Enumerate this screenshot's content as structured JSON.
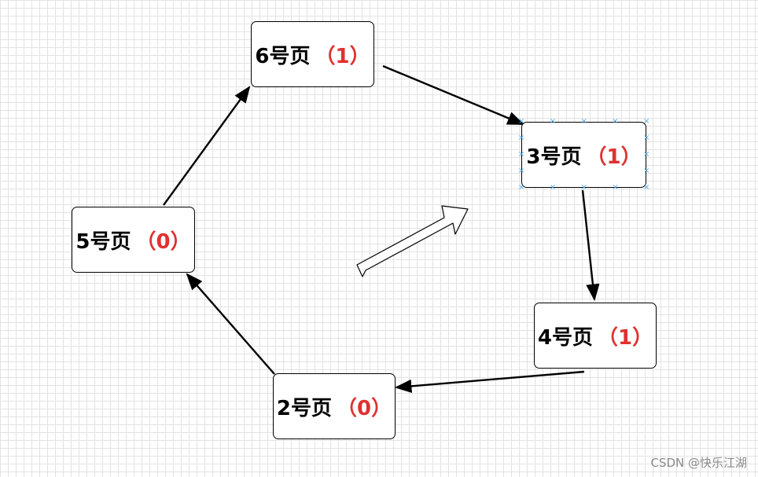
{
  "nodes": [
    {
      "id": "n6",
      "label": "6号页",
      "count": "（1）"
    },
    {
      "id": "n3",
      "label": "3号页",
      "count": "（1）",
      "selected": true
    },
    {
      "id": "n4",
      "label": "4号页",
      "count": "（1）"
    },
    {
      "id": "n2",
      "label": "2号页",
      "count": "（0）"
    },
    {
      "id": "n5",
      "label": "5号页",
      "count": "（0）"
    }
  ],
  "edges": [
    {
      "from": "n6",
      "to": "n3"
    },
    {
      "from": "n3",
      "to": "n4"
    },
    {
      "from": "n4",
      "to": "n2"
    },
    {
      "from": "n2",
      "to": "n5"
    },
    {
      "from": "n5",
      "to": "n6"
    }
  ],
  "colors": {
    "count_text": "#e03131",
    "grid": "#e3e3e3",
    "selection_handle": "#4aa8e8"
  },
  "watermark": "CSDN @快乐江湖"
}
